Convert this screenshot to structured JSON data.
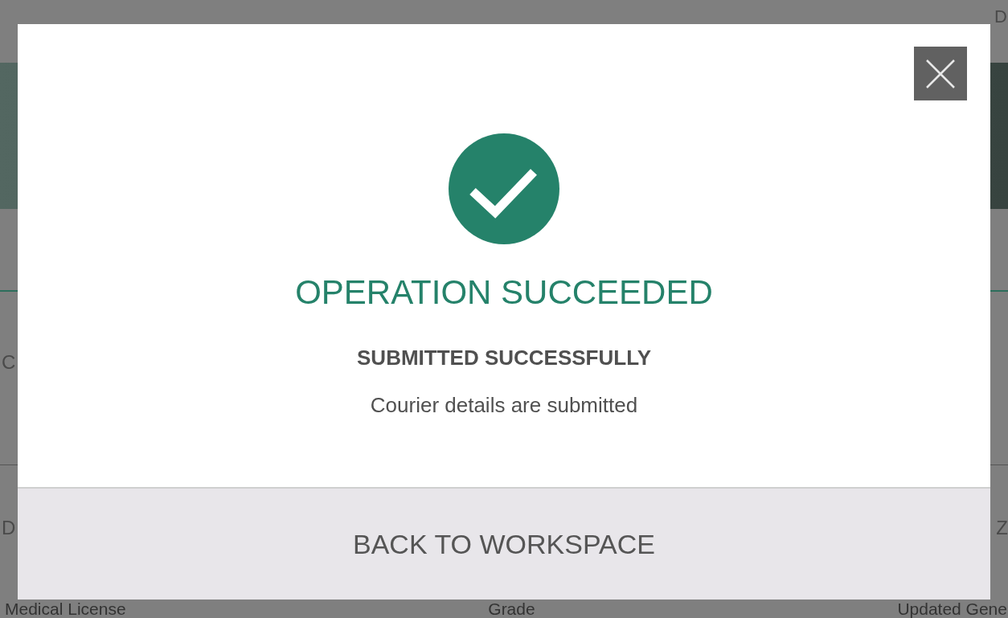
{
  "background_page": {
    "top_right_label": "D",
    "left_labels": [
      "C",
      "D"
    ],
    "right_labels": [
      "Z"
    ],
    "bottom_labels": [
      "Medical License",
      "Grade",
      "Updated Gene"
    ]
  },
  "dialog": {
    "title": "OPERATION SUCCEEDED",
    "subtitle": "SUBMITTED SUCCESSFULLY",
    "message": "Courier details are submitted",
    "button": "BACK TO WORKSPACE"
  }
}
